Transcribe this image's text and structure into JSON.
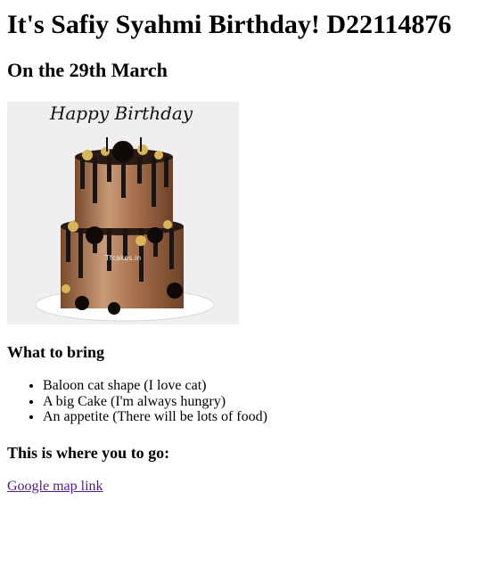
{
  "heading": "It's Safiy Syahmi Birthday! D22114876",
  "date": "On the 29th March",
  "image": {
    "topper_text": "Happy Birthday",
    "watermark": "Tfcakes.in",
    "alt_icon": "birthday-cake-photo"
  },
  "bring": {
    "title": "What to bring",
    "items": [
      "Baloon cat shape (I love cat)",
      "A big Cake (I'm always hungry)",
      "An appetite (There will be lots of food)"
    ]
  },
  "location": {
    "title": "This is where you to go:",
    "link_text": "Google map link"
  }
}
